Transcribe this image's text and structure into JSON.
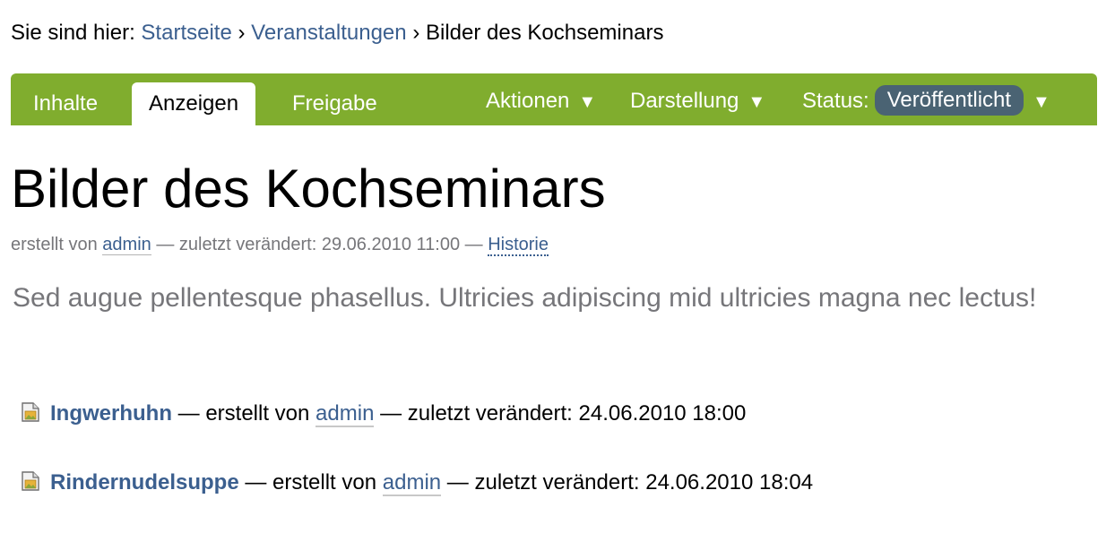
{
  "breadcrumb": {
    "prefix": "Sie sind hier:",
    "items": [
      "Startseite",
      "Veranstaltungen",
      "Bilder des Kochseminars"
    ],
    "separator": "›"
  },
  "editbar": {
    "tabs": [
      {
        "label": "Inhalte",
        "active": false
      },
      {
        "label": "Anzeigen",
        "active": true
      },
      {
        "label": "Freigabe",
        "active": false
      }
    ],
    "menus": {
      "actions": "Aktionen",
      "display": "Darstellung",
      "status_label": "Status:",
      "status_value": "Veröffentlicht",
      "arrow": "▼"
    },
    "color": "#80ad2e"
  },
  "page": {
    "title": "Bilder des Kochseminars",
    "byline": {
      "created_by": "erstellt von",
      "author": "admin",
      "modified": "— zuletzt verändert: 29.06.2010 11:00 —",
      "history": "Historie"
    },
    "description": "Sed augue pellentesque phasellus. Ultricies adipiscing mid ultricies magna nec lectus!"
  },
  "items": [
    {
      "icon": "document-icon",
      "title": "Ingwerhuhn",
      "created_by": "— erstellt von",
      "author": "admin",
      "modified": "— zuletzt verändert: 24.06.2010 18:00"
    },
    {
      "icon": "document-icon",
      "title": "Rindernudelsuppe",
      "created_by": "— erstellt von",
      "author": "admin",
      "modified": "— zuletzt verändert: 24.06.2010 18:04"
    }
  ],
  "colors": {
    "link": "#3b5f8f",
    "muted_text": "#76767a",
    "status_pill": "#4a6373"
  }
}
